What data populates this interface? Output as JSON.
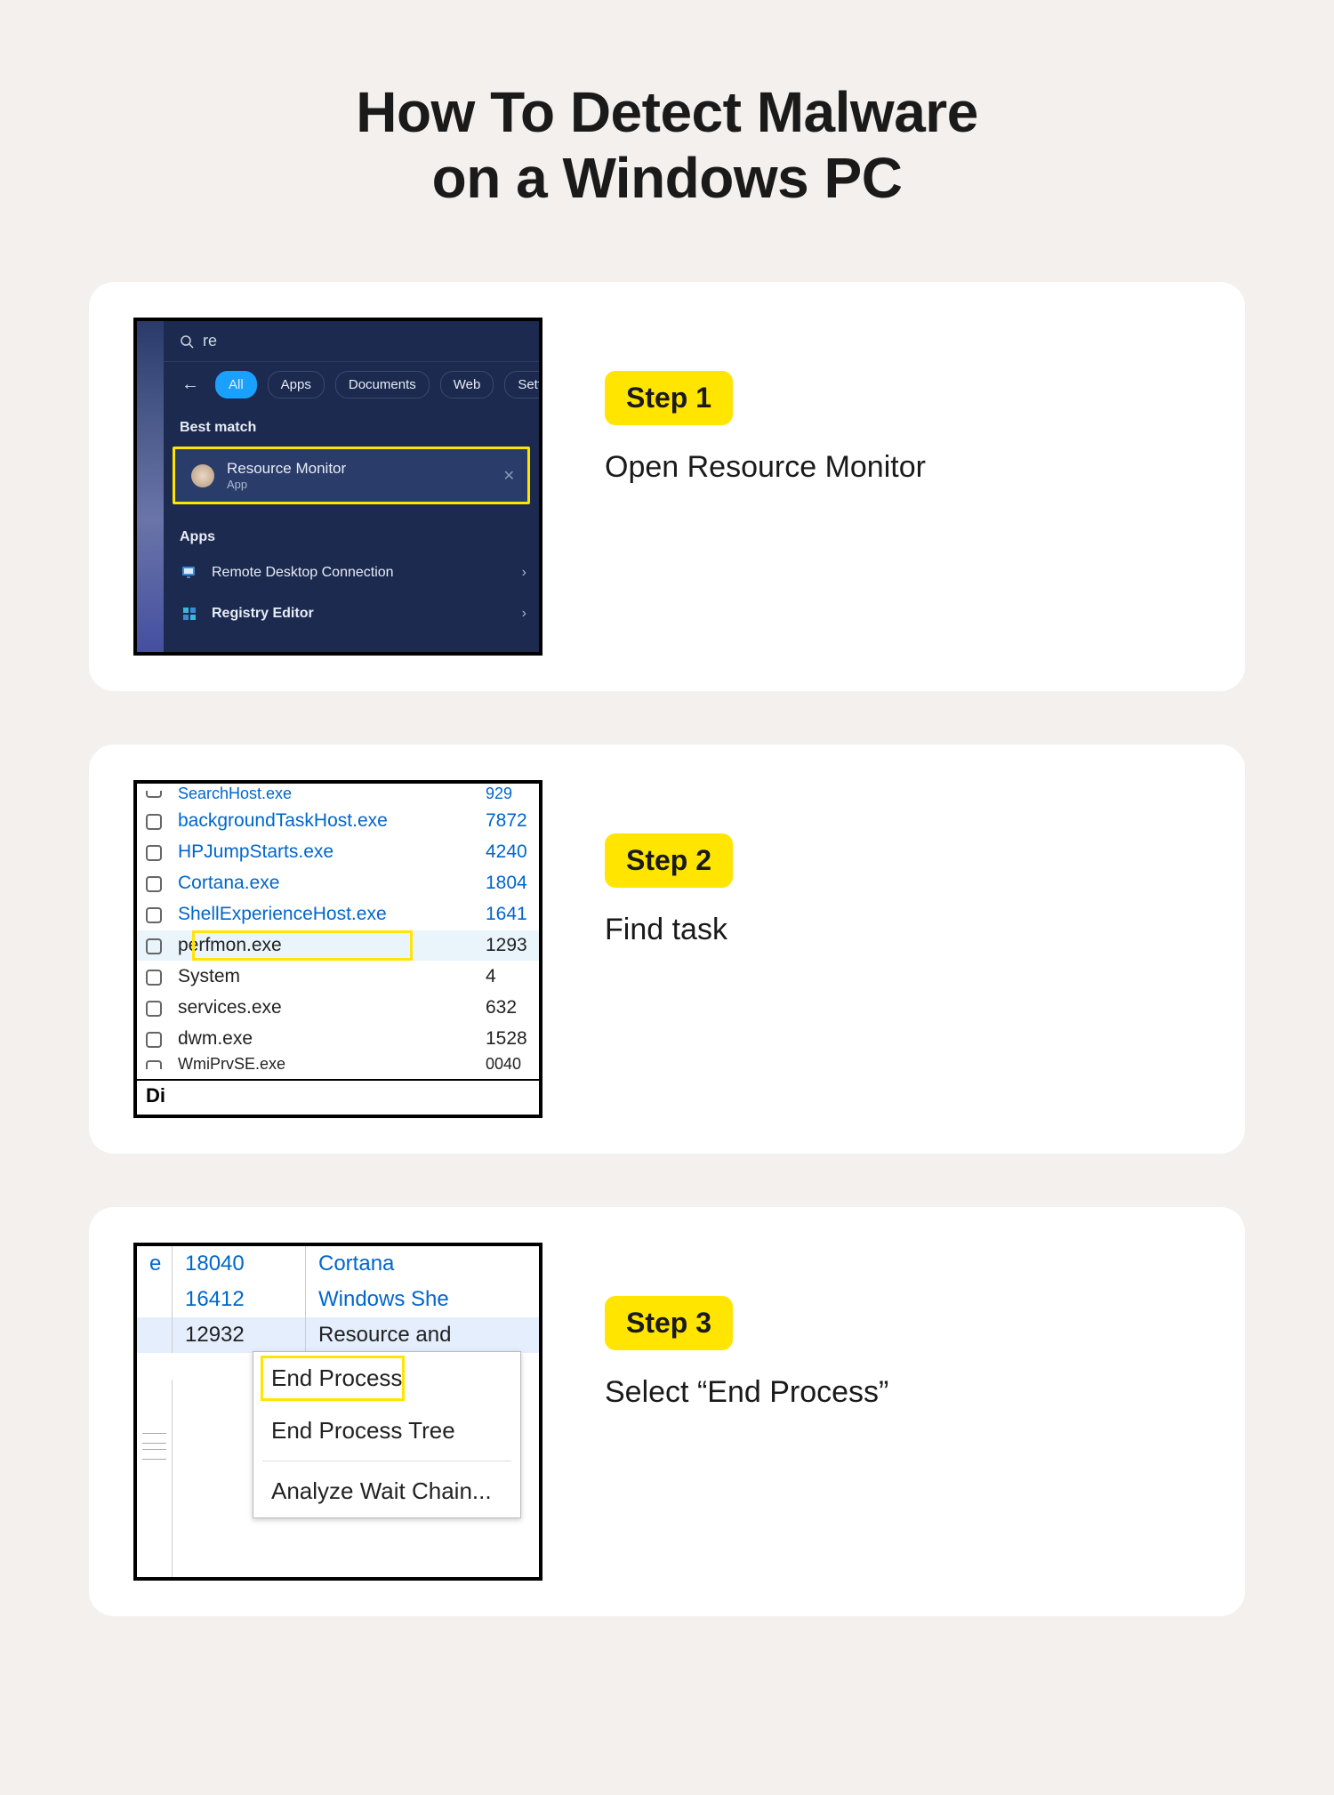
{
  "title_line1": "How To Detect Malware",
  "title_line2": "on a Windows PC",
  "steps": [
    {
      "pill": "Step 1",
      "desc": "Open Resource Monitor"
    },
    {
      "pill": "Step 2",
      "desc": "Find task"
    },
    {
      "pill": "Step 3",
      "desc": "Select “End Process”"
    }
  ],
  "s1": {
    "search_text": "re",
    "tabs": [
      "All",
      "Apps",
      "Documents",
      "Web",
      "Setting"
    ],
    "best_match_header": "Best match",
    "best": {
      "title": "Resource Monitor",
      "subtitle": "App"
    },
    "apps_header": "Apps",
    "apps": [
      {
        "name": "Remote Desktop Connection"
      },
      {
        "name": "Registry Editor"
      }
    ]
  },
  "s2": {
    "rows": [
      {
        "name": "backgroundTaskHost.exe",
        "pid": "7872",
        "link": true
      },
      {
        "name": "HPJumpStarts.exe",
        "pid": "4240",
        "link": true
      },
      {
        "name": "Cortana.exe",
        "pid": "1804",
        "link": true
      },
      {
        "name": "ShellExperienceHost.exe",
        "pid": "1641",
        "link": true
      },
      {
        "name": "perfmon.exe",
        "pid": "1293",
        "highlight": true
      },
      {
        "name": "System",
        "pid": "4"
      },
      {
        "name": "services.exe",
        "pid": "632"
      },
      {
        "name": "dwm.exe",
        "pid": "1528"
      }
    ],
    "cutoff_bottom": {
      "name": "WmiPrvSE.exe",
      "pid": "0040"
    },
    "footer_text": "Di"
  },
  "s3": {
    "rows": [
      {
        "a": "e",
        "pid": "18040",
        "desc": "Cortana"
      },
      {
        "a": "",
        "pid": "16412",
        "desc": "Windows She"
      },
      {
        "a": "",
        "pid": "12932",
        "desc": "Resource and",
        "selected": true
      }
    ],
    "menu": [
      "End Process",
      "End Process Tree",
      "Analyze Wait Chain..."
    ],
    "menu_highlight_index": 0
  }
}
